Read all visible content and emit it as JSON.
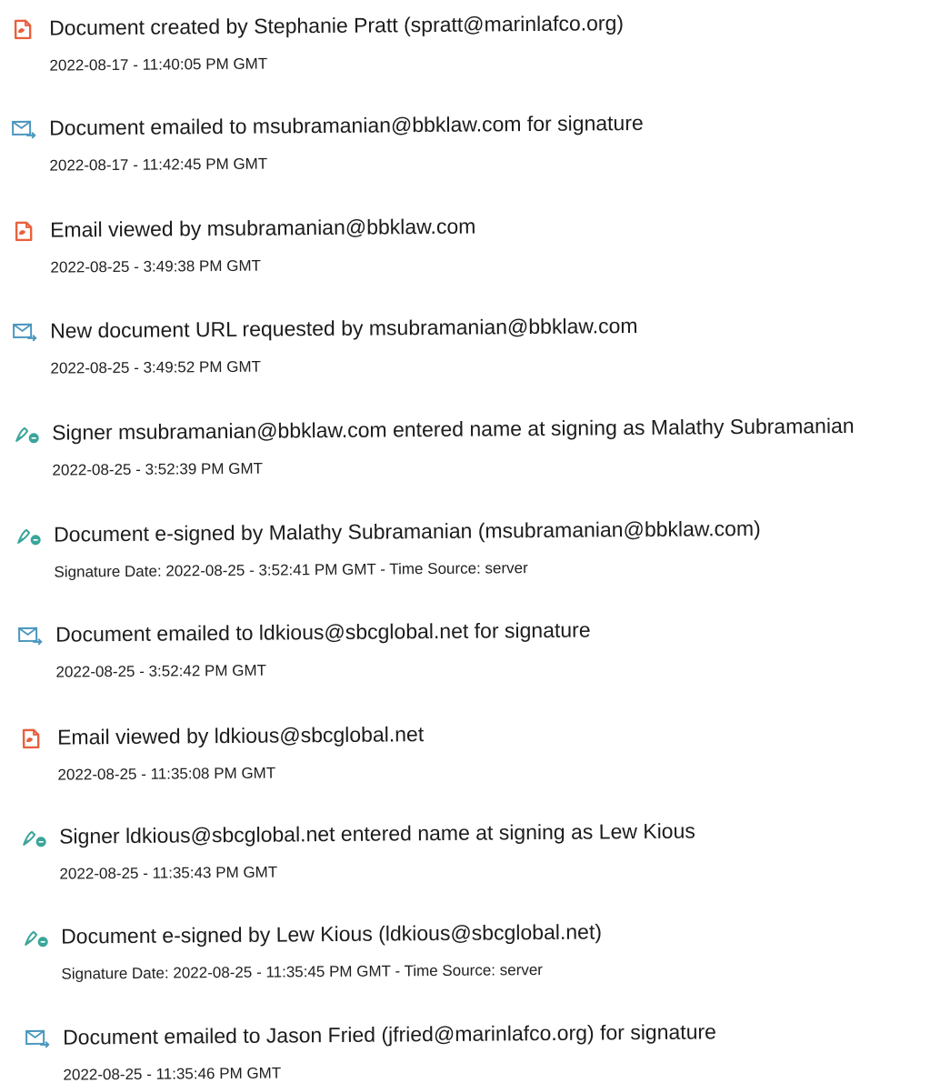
{
  "colors": {
    "view_icon": "#e8603c",
    "email_icon": "#4a96bf",
    "sign_icon": "#3aa59a"
  },
  "events": [
    {
      "icon": "document-view-icon",
      "title": "Document created by Stephanie Pratt (spratt@marinlafco.org)",
      "meta": "2022-08-17 - 11:40:05 PM GMT"
    },
    {
      "icon": "email-send-icon",
      "title": "Document emailed to msubramanian@bbklaw.com for signature",
      "meta": "2022-08-17 - 11:42:45 PM GMT"
    },
    {
      "icon": "document-view-icon",
      "title": "Email viewed by msubramanian@bbklaw.com",
      "meta": "2022-08-25 - 3:49:38 PM GMT"
    },
    {
      "icon": "email-send-icon",
      "title": "New document URL requested by msubramanian@bbklaw.com",
      "meta": "2022-08-25 - 3:49:52 PM GMT"
    },
    {
      "icon": "signature-pen-icon",
      "title": "Signer msubramanian@bbklaw.com entered name at signing as Malathy Subramanian",
      "meta": "2022-08-25 - 3:52:39 PM GMT"
    },
    {
      "icon": "signature-pen-icon",
      "title": "Document e-signed by Malathy Subramanian (msubramanian@bbklaw.com)",
      "meta": "Signature Date: 2022-08-25 - 3:52:41 PM GMT - Time Source: server"
    },
    {
      "icon": "email-send-icon",
      "title": "Document emailed to ldkious@sbcglobal.net for signature",
      "meta": "2022-08-25 - 3:52:42 PM GMT"
    },
    {
      "icon": "document-view-icon",
      "title": "Email viewed by ldkious@sbcglobal.net",
      "meta": "2022-08-25 - 11:35:08 PM GMT"
    },
    {
      "icon": "signature-pen-icon",
      "title": "Signer ldkious@sbcglobal.net entered name at signing as Lew Kious",
      "meta": "2022-08-25 - 11:35:43 PM GMT"
    },
    {
      "icon": "signature-pen-icon",
      "title": "Document e-signed by Lew Kious (ldkious@sbcglobal.net)",
      "meta": "Signature Date: 2022-08-25 - 11:35:45 PM GMT - Time Source: server"
    },
    {
      "icon": "email-send-icon",
      "title": "Document emailed to Jason Fried (jfried@marinlafco.org) for signature",
      "meta": "2022-08-25 - 11:35:46 PM GMT"
    }
  ]
}
